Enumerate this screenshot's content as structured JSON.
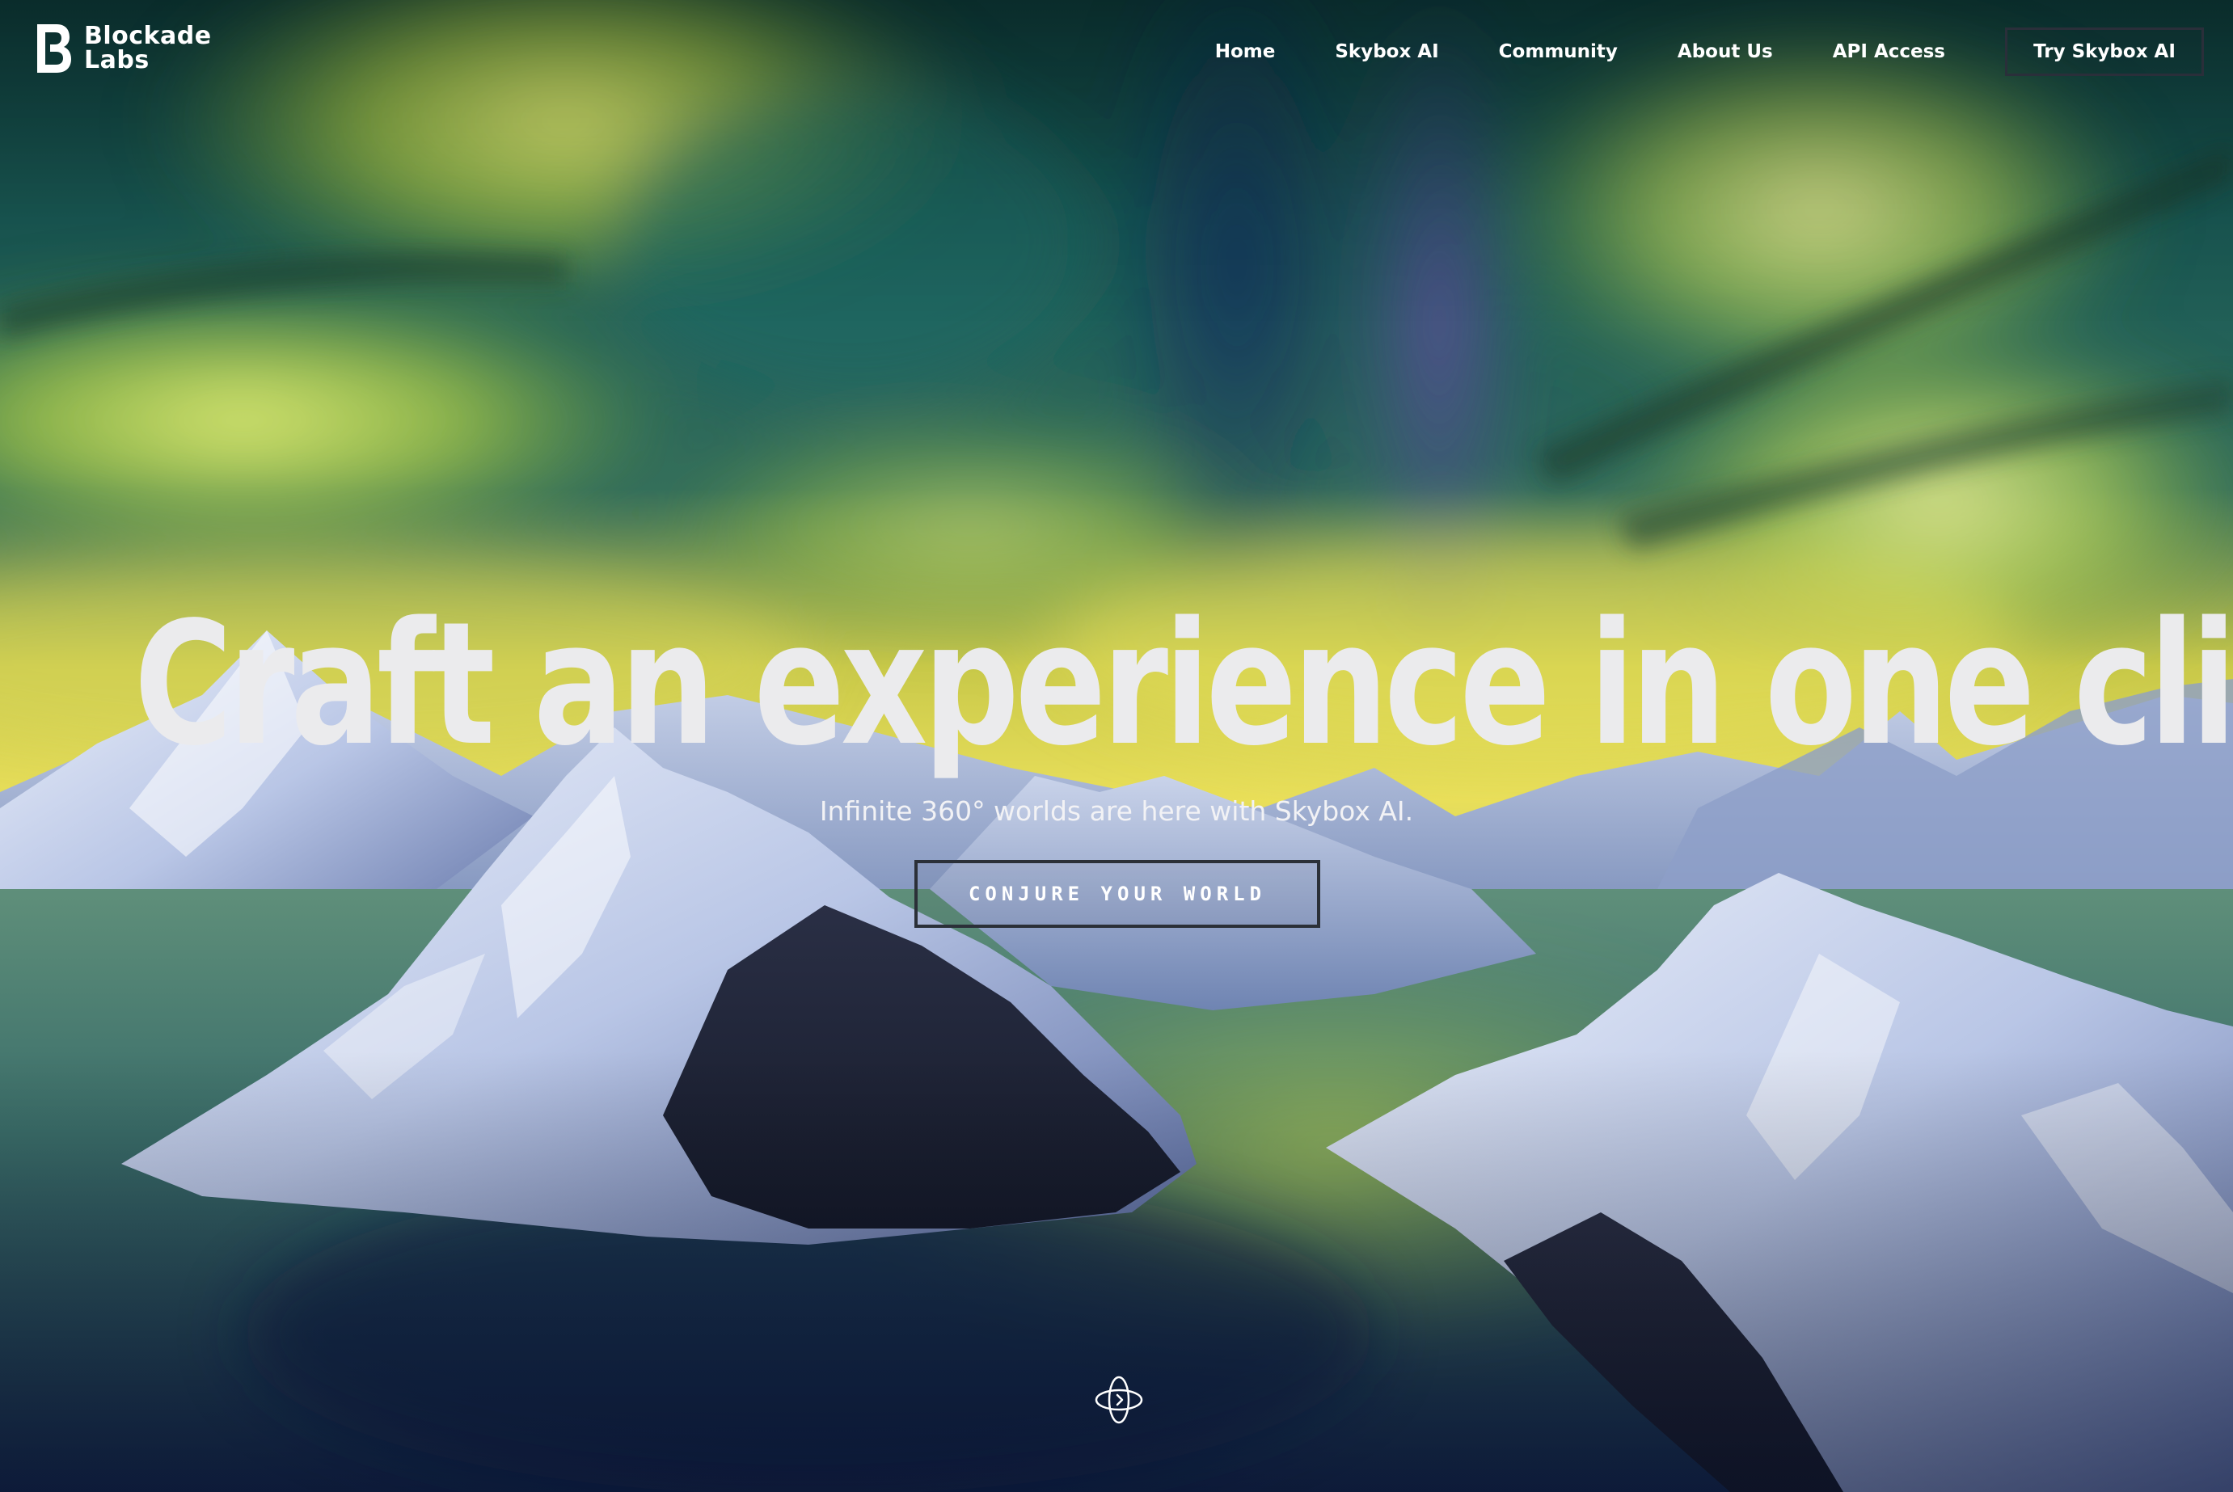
{
  "brand": {
    "name_line1": "Blockade",
    "name_line2": "Labs"
  },
  "nav": {
    "items": [
      {
        "label": "Home"
      },
      {
        "label": "Skybox AI"
      },
      {
        "label": "Community"
      },
      {
        "label": "About Us"
      },
      {
        "label": "API Access"
      }
    ],
    "cta_label": "Try Skybox AI"
  },
  "hero": {
    "title": "Craft an experience in one click",
    "subtitle": "Infinite 360° worlds are here with Skybox AI.",
    "cta_label": "CONJURE YOUR WORLD"
  },
  "icons": {
    "logo": "blockade-labs-logo-icon",
    "scroll": "orbit-360-icon"
  },
  "colors": {
    "text_primary": "#ffffff",
    "title": "#ebebed",
    "button_border": "#2b3038"
  }
}
